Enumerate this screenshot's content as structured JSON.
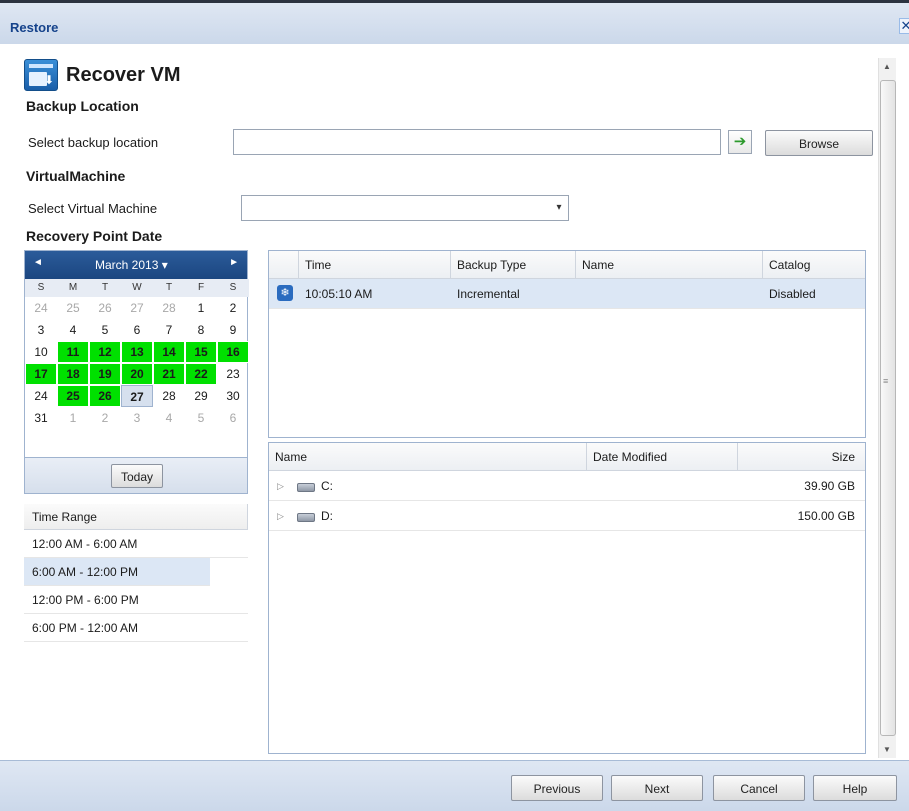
{
  "window": {
    "title": "Restore",
    "close_glyph": "✕"
  },
  "page": {
    "title": "Recover VM",
    "icon": "recover-vm-icon"
  },
  "backup_location": {
    "section_title": "Backup Location",
    "label": "Select backup location",
    "value": "",
    "go_glyph": "➔",
    "browse_label": "Browse"
  },
  "virtual_machine": {
    "section_title": "VirtualMachine",
    "label": "Select Virtual Machine",
    "value": "",
    "dropdown_glyph": "▾"
  },
  "recovery_point": {
    "section_title": "Recovery Point Date",
    "calendar": {
      "month_label": "March 2013 ▾",
      "prev_glyph": "◄",
      "next_glyph": "►",
      "dow": [
        "S",
        "M",
        "T",
        "W",
        "T",
        "F",
        "S"
      ],
      "days": [
        {
          "d": "24",
          "other": true
        },
        {
          "d": "25",
          "other": true
        },
        {
          "d": "26",
          "other": true
        },
        {
          "d": "27",
          "other": true
        },
        {
          "d": "28",
          "other": true
        },
        {
          "d": "1"
        },
        {
          "d": "2"
        },
        {
          "d": "3"
        },
        {
          "d": "4"
        },
        {
          "d": "5"
        },
        {
          "d": "6"
        },
        {
          "d": "7"
        },
        {
          "d": "8"
        },
        {
          "d": "9"
        },
        {
          "d": "10"
        },
        {
          "d": "11",
          "hl": true
        },
        {
          "d": "12",
          "hl": true
        },
        {
          "d": "13",
          "hl": true
        },
        {
          "d": "14",
          "hl": true
        },
        {
          "d": "15",
          "hl": true
        },
        {
          "d": "16",
          "hl": true
        },
        {
          "d": "17",
          "hl": true
        },
        {
          "d": "18",
          "hl": true
        },
        {
          "d": "19",
          "hl": true
        },
        {
          "d": "20",
          "hl": true
        },
        {
          "d": "21",
          "hl": true
        },
        {
          "d": "22",
          "hl": true
        },
        {
          "d": "23"
        },
        {
          "d": "24"
        },
        {
          "d": "25",
          "hl": true
        },
        {
          "d": "26",
          "hl": true
        },
        {
          "d": "27",
          "sel": true
        },
        {
          "d": "28"
        },
        {
          "d": "29"
        },
        {
          "d": "30"
        },
        {
          "d": "31"
        },
        {
          "d": "1",
          "other": true
        },
        {
          "d": "2",
          "other": true
        },
        {
          "d": "3",
          "other": true
        },
        {
          "d": "4",
          "other": true
        },
        {
          "d": "5",
          "other": true
        },
        {
          "d": "6",
          "other": true
        }
      ],
      "today_label": "Today",
      "highlight_color": "#00e000"
    },
    "time_range": {
      "header": "Time Range",
      "items": [
        "12:00 AM - 6:00 AM",
        "6:00 AM - 12:00 PM",
        "12:00 PM - 6:00 PM",
        "6:00 PM - 12:00 AM"
      ],
      "selected": "6:00 AM - 12:00 PM"
    }
  },
  "recovery_points_table": {
    "columns": [
      "Time",
      "Backup Type",
      "Name",
      "Catalog"
    ],
    "rows": [
      {
        "time": "10:05:10 AM",
        "backup_type": "Incremental",
        "name": "",
        "catalog": "Disabled",
        "icon": "snapshot-icon"
      }
    ]
  },
  "volumes_table": {
    "columns": [
      "Name",
      "Date Modified",
      "Size"
    ],
    "rows": [
      {
        "name": "C:",
        "date_modified": "",
        "size": "39.90 GB",
        "icon": "drive-icon"
      },
      {
        "name": "D:",
        "date_modified": "",
        "size": "150.00 GB",
        "icon": "drive-icon"
      }
    ],
    "expander_glyph": "▷"
  },
  "footer": {
    "previous": "Previous",
    "next": "Next",
    "cancel": "Cancel",
    "help": "Help"
  },
  "colors": {
    "accent": "#15428b",
    "header_bg": "#cbd8ea",
    "calendar_header": "#1b4680",
    "selection": "#dce7f5"
  }
}
